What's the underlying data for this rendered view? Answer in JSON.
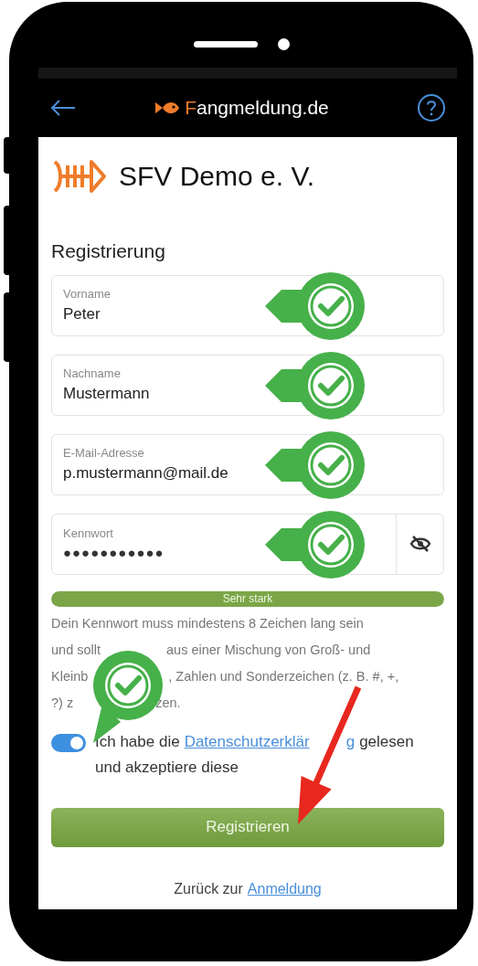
{
  "header": {
    "title": "Fangmeldung.de"
  },
  "club": {
    "name": "SFV Demo e. V."
  },
  "form": {
    "title": "Registrierung",
    "fields": [
      {
        "label": "Vorname",
        "value": "Peter",
        "kind": "text",
        "check_marker": true
      },
      {
        "label": "Nachname",
        "value": "Mustermann",
        "kind": "text",
        "check_marker": true
      },
      {
        "label": "E-Mail-Adresse",
        "value": "p.mustermann@mail.de",
        "kind": "text",
        "check_marker": true
      },
      {
        "label": "Kennwort",
        "value": "●●●●●●●●●●●",
        "kind": "password",
        "check_marker": true
      }
    ]
  },
  "strength": {
    "label": "Sehr stark",
    "level": 1
  },
  "hint_lines": [
    [
      "Dein Kennwort muss mindestens 8 Zeichen lang sein"
    ],
    [
      "und sollt",
      "aus einer Mischung von Groß- und"
    ],
    [
      "Kleinb",
      ", Zahlen und Sonderzeichen (z. B. #, +,"
    ],
    [
      "?) z",
      "zen."
    ]
  ],
  "consent": {
    "on": true,
    "check_marker": true,
    "before": "Ich habe die",
    "link_parts": [
      "Datenschutzerklär",
      "g"
    ],
    "after": "gelesen",
    "line2": "und akzeptiere diese"
  },
  "submit": {
    "label": "Registrieren"
  },
  "footer": {
    "text": "Zurück zur",
    "link": "Anmeldung"
  }
}
